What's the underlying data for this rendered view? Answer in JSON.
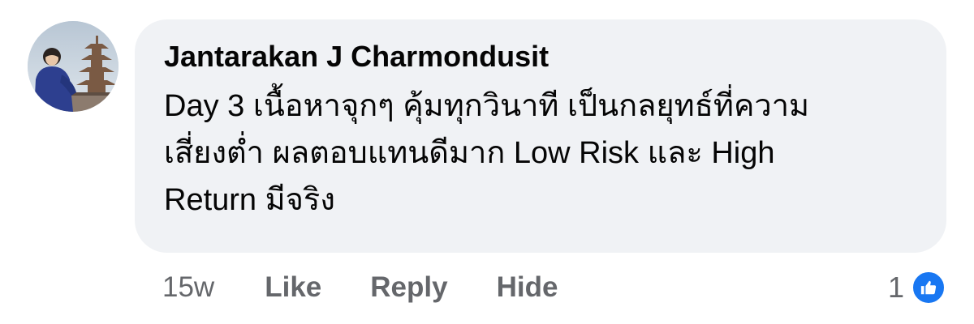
{
  "comment": {
    "author": "Jantarakan J Charmondusit",
    "text": "Day 3 เนื้อหาจุกๆ คุ้มทุกวินาที เป็นกลยุทธ์ที่ความ\nเสี่ยงต่ำ ผลตอบแทนดีมาก Low Risk และ High\nReturn มีจริง",
    "avatar_icon": "profile-photo-pagoda",
    "bubble_color": "#f0f2f5"
  },
  "actions": {
    "timestamp": "15w",
    "like_label": "Like",
    "reply_label": "Reply",
    "hide_label": "Hide"
  },
  "reactions": {
    "count": "1",
    "icon": "thumbs-up-icon",
    "color": "#1877f2"
  }
}
